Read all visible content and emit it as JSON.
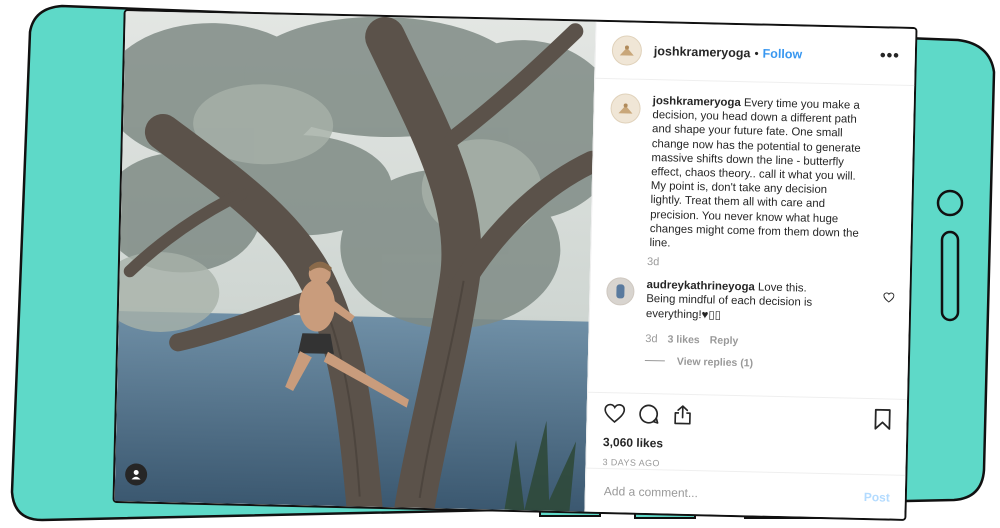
{
  "colors": {
    "frame": "#5ed9c8",
    "accent": "#3897f0",
    "muted": "#999999"
  },
  "post": {
    "username": "joshkrameryoga",
    "separator": "•",
    "follow_label": "Follow",
    "more_icon": "more-horizontal-icon",
    "caption": "Every time you make a decision, you head down a different path and shape your future fate. One small change now has the potential to generate massive shifts down the line - butterfly effect, chaos theory.. call it what you will. My point is, don't take any decision lightly. Treat them all with care and precision. You never know what huge changes might come from them down the line.",
    "caption_time": "3d",
    "likes": "3,060 likes",
    "posted_ago": "3 DAYS AGO"
  },
  "comment": {
    "username": "audreykathrineyoga",
    "text": "Love this. Being mindful of each decision is everything!♥▯▯",
    "time": "3d",
    "likes": "3 likes",
    "reply_label": "Reply",
    "view_replies": "View replies (1)"
  },
  "composer": {
    "placeholder": "Add a comment...",
    "post_label": "Post"
  }
}
